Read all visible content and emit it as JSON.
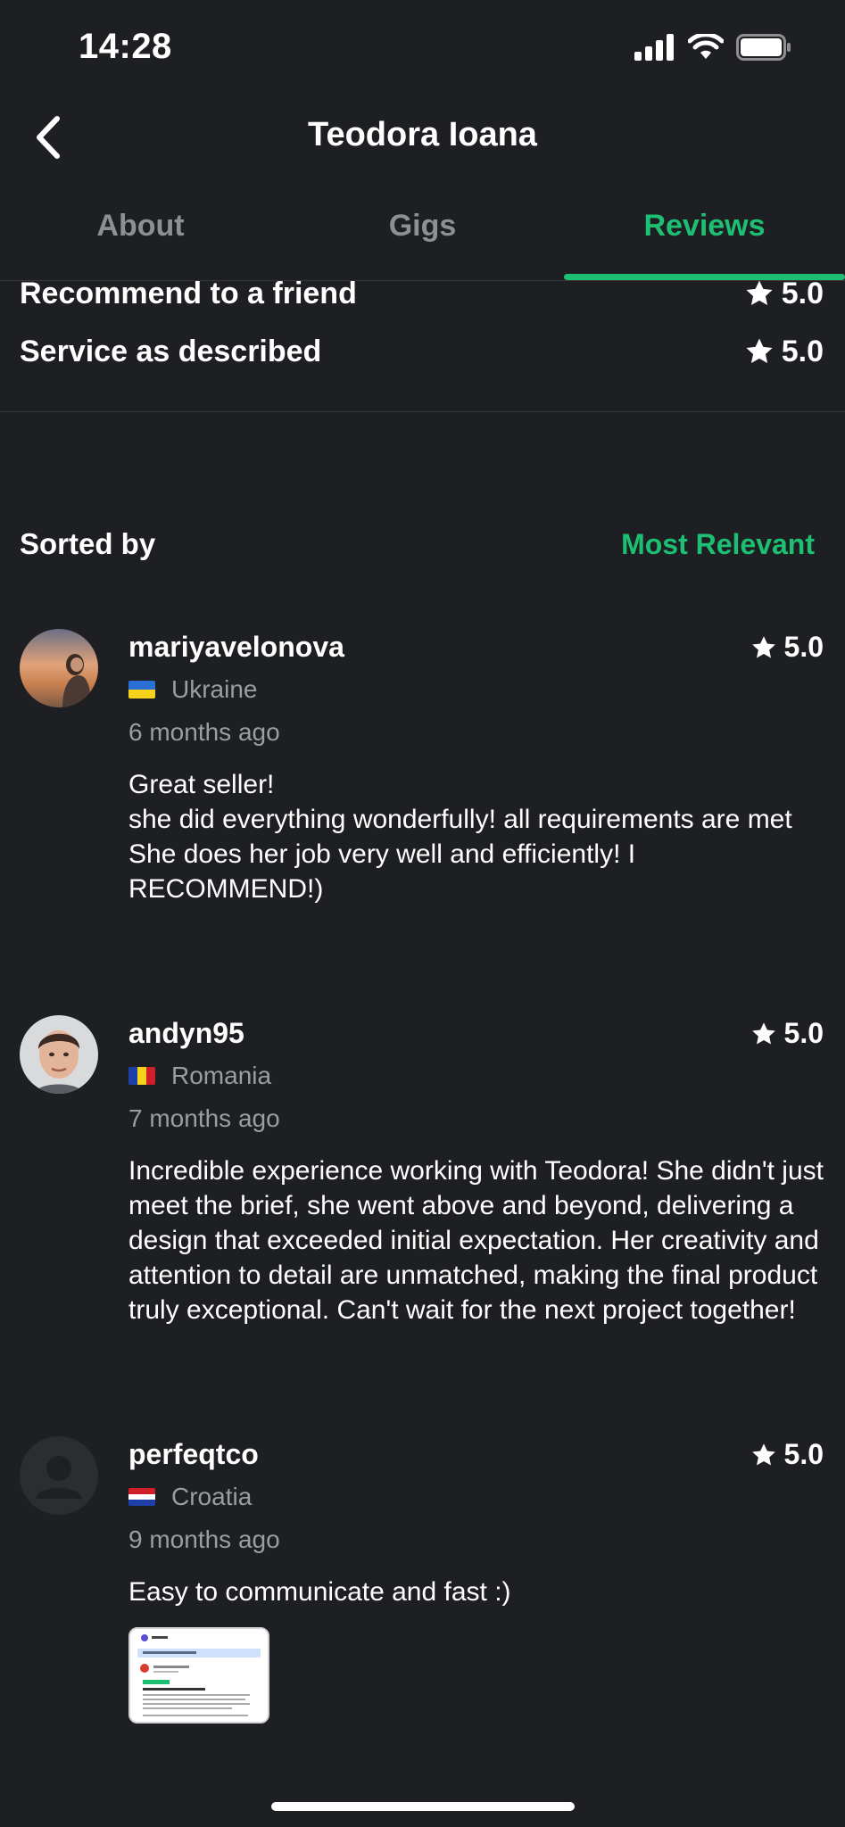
{
  "status": {
    "time": "14:28"
  },
  "header": {
    "title": "Teodora Ioana"
  },
  "tabs": [
    {
      "label": "About"
    },
    {
      "label": "Gigs"
    },
    {
      "label": "Reviews"
    }
  ],
  "ratings": [
    {
      "label": "Recommend to a friend",
      "value": "5.0"
    },
    {
      "label": "Service as described",
      "value": "5.0"
    }
  ],
  "sort": {
    "label": "Sorted by",
    "value": "Most Relevant"
  },
  "reviews": [
    {
      "name": "mariyavelonova",
      "country": "Ukraine",
      "date": "6 months ago",
      "rating": "5.0",
      "text": "Great seller!\nshe did everything wonderfully! all requirements are met\nShe does her job very well and efficiently! I RECOMMEND!)"
    },
    {
      "name": "andyn95",
      "country": "Romania",
      "date": "7 months ago",
      "rating": "5.0",
      "text": "Incredible experience working with Teodora! She didn't just meet the brief, she went above and beyond, delivering a design that exceeded initial expectation. Her creativity and attention to detail are unmatched, making the final product truly exceptional. Can't wait for the next project together!"
    },
    {
      "name": "perfeqtco",
      "country": "Croatia",
      "date": "9 months ago",
      "rating": "5.0",
      "text": "Easy to communicate and fast :)"
    }
  ],
  "colors": {
    "background": "#1e1f22",
    "accent": "#1dbf73",
    "muted_text": "#9a9da2"
  },
  "icons": {
    "back": "chevron-left-icon",
    "star": "star-icon",
    "signal": "signal-icon",
    "wifi": "wifi-icon",
    "battery": "battery-icon"
  }
}
